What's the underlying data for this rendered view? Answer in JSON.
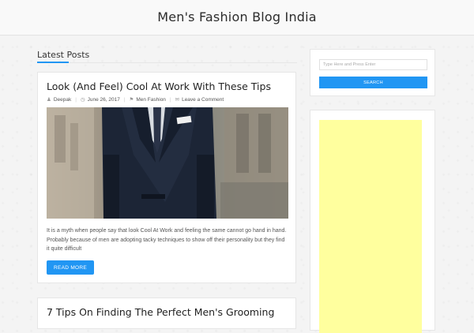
{
  "site": {
    "title": "Men's Fashion Blog India"
  },
  "main": {
    "section_title": "Latest Posts",
    "posts": [
      {
        "title": "Look (And Feel) Cool At Work With These Tips",
        "author": "Deepak",
        "date": "June 26, 2017",
        "category": "Men Fashion",
        "comments": "Leave a Comment",
        "excerpt": "It is a myth when people say that look Cool At Work and feeling the same cannot go hand in hand. Probably because of men are adopting tacky techniques to show off their personality but they find it quite difficult",
        "read_more": "READ MORE"
      },
      {
        "title": "7 Tips On Finding The Perfect Men's Grooming"
      }
    ]
  },
  "sidebar": {
    "search": {
      "placeholder": "Type Here and Press Enter",
      "button_label": "SEARCH"
    },
    "ad": {
      "color": "#ffff9e"
    }
  },
  "colors": {
    "accent": "#2196f3",
    "background": "#f4f4f4",
    "card": "#ffffff"
  },
  "icons": {
    "author": "user-icon",
    "date": "clock-icon",
    "category": "tag-icon",
    "comments": "comment-icon"
  }
}
